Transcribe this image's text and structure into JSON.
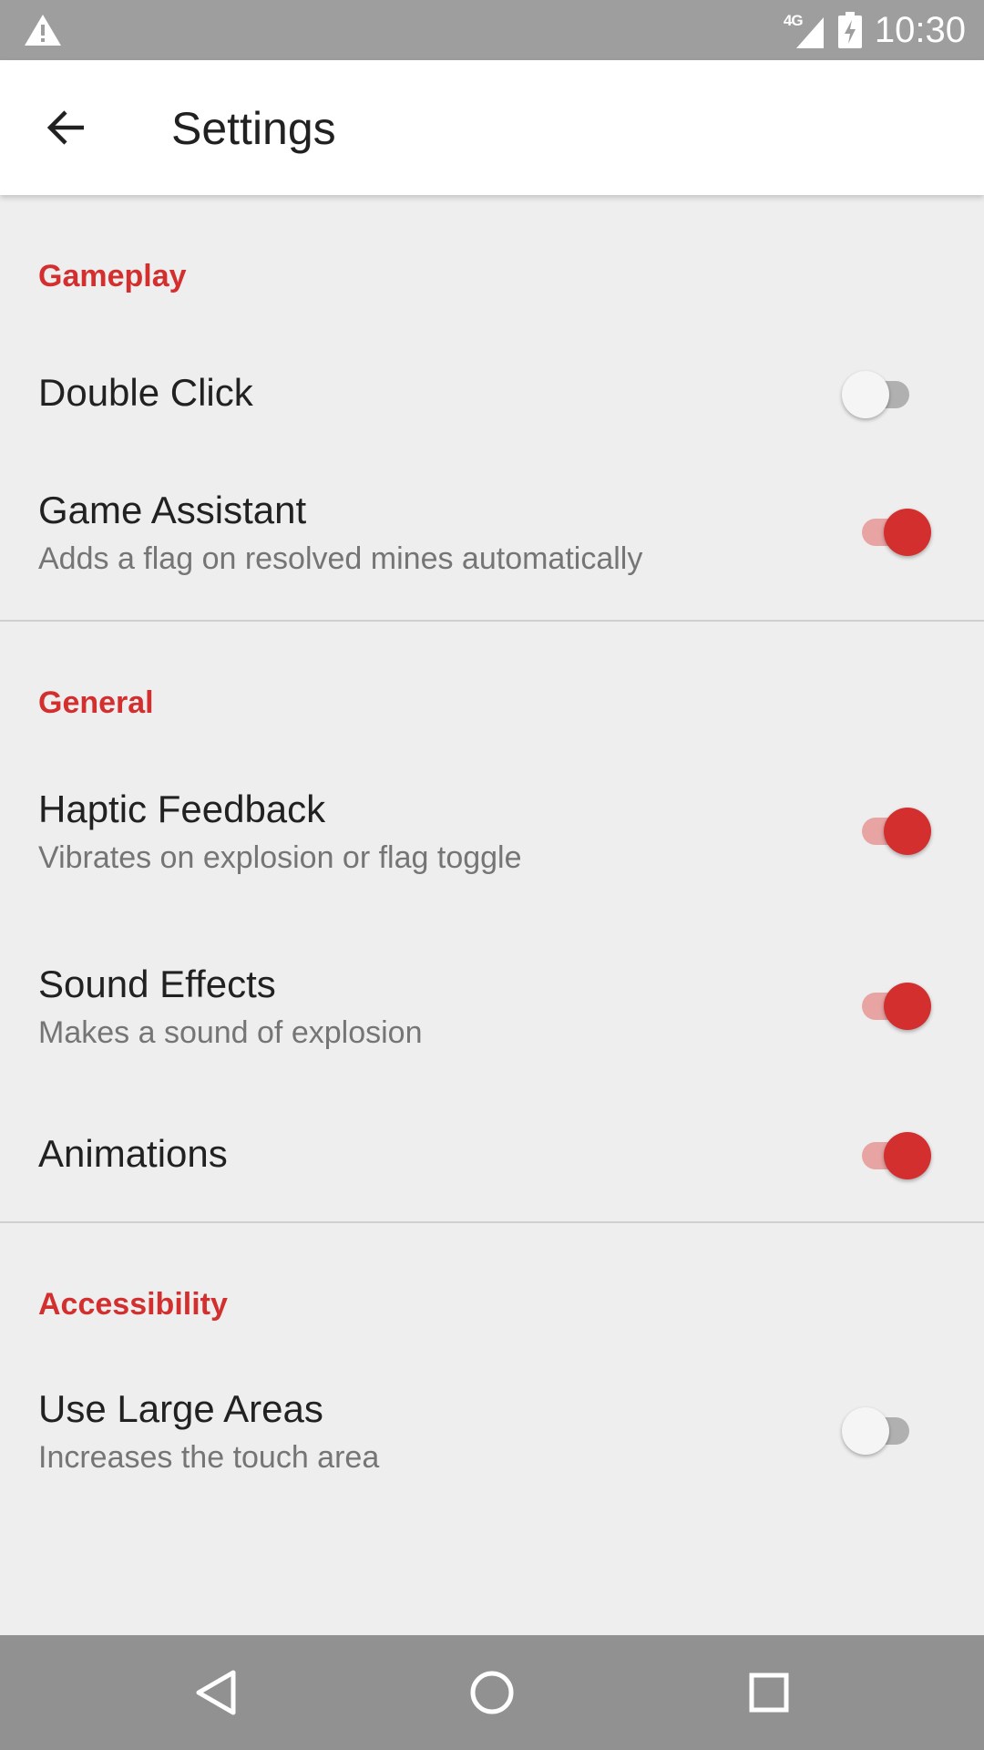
{
  "status_bar": {
    "network": "4G",
    "time": "10:30",
    "icons": [
      "warning-icon",
      "signal-icon",
      "battery-charging-icon"
    ]
  },
  "app_bar": {
    "title": "Settings",
    "back_icon": "arrow-left-icon"
  },
  "sections": [
    {
      "header": "Gameplay",
      "items": [
        {
          "title": "Double Click",
          "summary": "",
          "enabled": false
        },
        {
          "title": "Game Assistant",
          "summary": "Adds a flag on resolved mines automatically",
          "enabled": true
        }
      ]
    },
    {
      "header": "General",
      "items": [
        {
          "title": "Haptic Feedback",
          "summary": "Vibrates on explosion or flag toggle",
          "enabled": true
        },
        {
          "title": "Sound Effects",
          "summary": "Makes a sound of explosion",
          "enabled": true
        },
        {
          "title": "Animations",
          "summary": "",
          "enabled": true
        }
      ]
    },
    {
      "header": "Accessibility",
      "items": [
        {
          "title": "Use Large Areas",
          "summary": "Increases the touch area",
          "enabled": false
        }
      ]
    }
  ],
  "nav_bar": {
    "icons": [
      "back-triangle-icon",
      "home-circle-icon",
      "recents-square-icon"
    ]
  },
  "colors": {
    "accent": "#d32f2f",
    "status_bar": "#9e9e9e",
    "nav_bar": "#919191",
    "background": "#eeeeee"
  }
}
